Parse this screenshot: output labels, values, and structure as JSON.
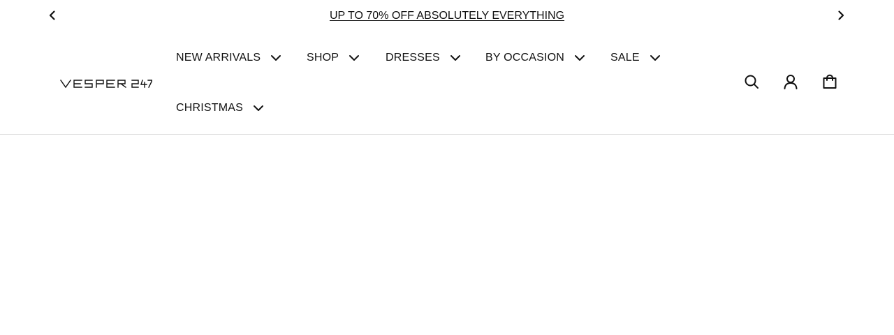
{
  "announcement": {
    "text": "UP TO 70% OFF ABSOLUTELY EVERYTHING",
    "prev_icon": "chevron-left-icon",
    "next_icon": "chevron-right-icon"
  },
  "brand": {
    "logo_text": "VESPER 247"
  },
  "nav": {
    "items": [
      {
        "label": "NEW ARRIVALS",
        "icon": "chevron-down-icon"
      },
      {
        "label": "SHOP",
        "icon": "chevron-down-icon"
      },
      {
        "label": "DRESSES",
        "icon": "chevron-down-icon"
      },
      {
        "label": "BY OCCASION",
        "icon": "chevron-down-icon"
      },
      {
        "label": "SALE",
        "icon": "chevron-down-icon"
      },
      {
        "label": "CHRISTMAS",
        "icon": "chevron-down-icon"
      }
    ]
  },
  "utilities": {
    "icons": [
      "search-icon",
      "account-icon",
      "cart-icon"
    ]
  },
  "colors": {
    "text": "#111111",
    "background": "#ffffff",
    "divider": "#dedede"
  }
}
